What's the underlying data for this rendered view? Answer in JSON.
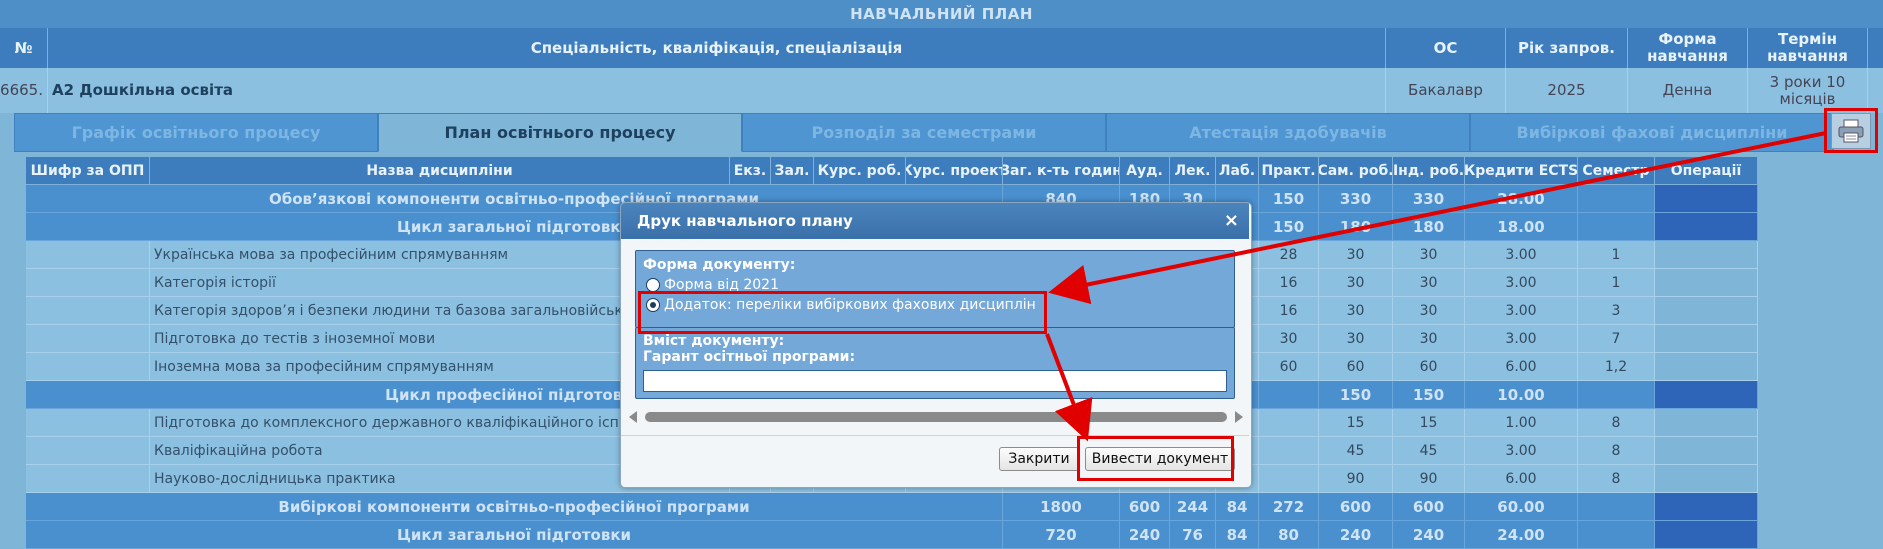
{
  "window_title": "НАВЧАЛЬНИЙ ПЛАН",
  "header": [
    "№",
    "Спеціальність, кваліфікація, спеціалізація",
    "ОС",
    "Рік запров.",
    "Форма навчання",
    "Термін навчання"
  ],
  "program": {
    "no": "6665.",
    "name": "А2 Дошкільна освіта",
    "level": "Бакалавр",
    "year": "2025",
    "form": "Денна",
    "term": "3 роки 10 місяців"
  },
  "tabs": [
    "Графік освітнього процесу",
    "План освітнього процесу",
    "Розподіл за семестрами",
    "Атестація здобувачів",
    "Вибіркові фахові дисципліни"
  ],
  "active_tab": 1,
  "print_icon": "printer-icon",
  "table": {
    "columns": [
      "Шифр за ОПП",
      "Назва дисципліни",
      "Екз.",
      "Зал.",
      "Курс. роб.",
      "Курс. проект",
      "Заг. к-ть годин",
      "Ауд.",
      "Лек.",
      "Лаб.",
      "Практ.",
      "Сам. роб.",
      "Інд. роб.",
      "Кредити ECTS",
      "Семестр",
      "Операції"
    ],
    "rows": [
      {
        "type": "group",
        "name": "Обов’язкові компоненти освітньо-професійної програми",
        "total": "840",
        "aud": "180",
        "lec": "30",
        "lab": "",
        "prac": "150",
        "self": "330",
        "ind": "330",
        "ects": "28.00",
        "sem": ""
      },
      {
        "type": "group",
        "name": "Цикл загальної підготовки",
        "total": "",
        "aud": "",
        "lec": "",
        "lab": "",
        "prac": "150",
        "self": "180",
        "ind": "180",
        "ects": "18.00",
        "sem": ""
      },
      {
        "type": "data",
        "name": "Українська мова за професійним спрямуванням",
        "total": "",
        "aud": "",
        "lec": "",
        "lab": "",
        "prac": "28",
        "self": "30",
        "ind": "30",
        "ects": "3.00",
        "sem": "1"
      },
      {
        "type": "data",
        "name": "Категорія історії",
        "total": "",
        "aud": "",
        "lec": "",
        "lab": "",
        "prac": "16",
        "self": "30",
        "ind": "30",
        "ects": "3.00",
        "sem": "1"
      },
      {
        "type": "data",
        "name": "Категорія здоров’я і безпеки людини та базова загальновійськова",
        "total": "",
        "aud": "",
        "lec": "",
        "lab": "",
        "prac": "16",
        "self": "30",
        "ind": "30",
        "ects": "3.00",
        "sem": "3"
      },
      {
        "type": "data",
        "name": "Підготовка до тестів з іноземної мови",
        "total": "",
        "aud": "",
        "lec": "",
        "lab": "",
        "prac": "30",
        "self": "30",
        "ind": "30",
        "ects": "3.00",
        "sem": "7"
      },
      {
        "type": "data",
        "name": "Іноземна мова за професійним спрямуванням",
        "total": "",
        "aud": "",
        "lec": "",
        "lab": "",
        "prac": "60",
        "self": "60",
        "ind": "60",
        "ects": "6.00",
        "sem": "1,2"
      },
      {
        "type": "group",
        "name": "Цикл професійної підготовки",
        "total": "",
        "aud": "",
        "lec": "",
        "lab": "",
        "prac": "",
        "self": "150",
        "ind": "150",
        "ects": "10.00",
        "sem": ""
      },
      {
        "type": "data",
        "name": "Підготовка до комплексного державного кваліфікаційного іспиту",
        "total": "",
        "aud": "",
        "lec": "",
        "lab": "",
        "prac": "",
        "self": "15",
        "ind": "15",
        "ects": "1.00",
        "sem": "8"
      },
      {
        "type": "data",
        "name": "Кваліфікаційна робота",
        "total": "",
        "aud": "",
        "lec": "",
        "lab": "",
        "prac": "",
        "self": "45",
        "ind": "45",
        "ects": "3.00",
        "sem": "8"
      },
      {
        "type": "data",
        "name": "Науково-дослідницька практика",
        "total": "",
        "aud": "",
        "lec": "",
        "lab": "",
        "prac": "",
        "self": "90",
        "ind": "90",
        "ects": "6.00",
        "sem": "8"
      },
      {
        "type": "group",
        "name": "Вибіркові компоненти освітньо-професійної програми",
        "total": "1800",
        "aud": "600",
        "lec": "244",
        "lab": "84",
        "prac": "272",
        "self": "600",
        "ind": "600",
        "ects": "60.00",
        "sem": ""
      },
      {
        "type": "group",
        "name": "Цикл загальної підготовки",
        "total": "720",
        "aud": "240",
        "lec": "76",
        "lab": "84",
        "prac": "80",
        "self": "240",
        "ind": "240",
        "ects": "24.00",
        "sem": ""
      }
    ]
  },
  "dialog": {
    "title": "Друк навчального плану",
    "close_glyph": "×",
    "form_legend": "Форма документу:",
    "option1": "Форма від 2021",
    "option2": "Додаток: переліки вибіркових фахових дисциплін",
    "selected_option": 2,
    "content_legend": "Вміст документу:",
    "guarantor_label": "Гарант осітньої програми:",
    "guarantor_value": "",
    "close_button": "Закрити",
    "print_button": "Вивести документ"
  },
  "annotation_color": "#e00000"
}
